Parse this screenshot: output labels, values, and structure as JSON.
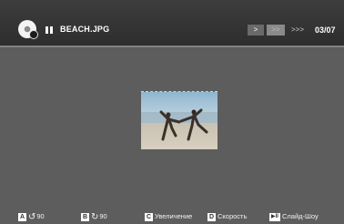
{
  "header": {
    "filename": "BEACH.JPG",
    "nav": {
      "next": ">",
      "fast": ">>",
      "faster": ">>>"
    },
    "counter": "03/07"
  },
  "hints": {
    "rotate_left": {
      "key": "A",
      "label": "90"
    },
    "rotate_right": {
      "key": "B",
      "label": "90"
    },
    "zoom": {
      "key": "C",
      "label": "Увеличение"
    },
    "speed": {
      "key": "D",
      "label": "Скорость"
    },
    "slideshow": {
      "key": "▶II",
      "label": "Слайд-Шоу"
    }
  },
  "icons": [
    "disc-icon",
    "pause-icon",
    "rotate-left-icon",
    "rotate-right-icon",
    "play-pause-icon"
  ]
}
